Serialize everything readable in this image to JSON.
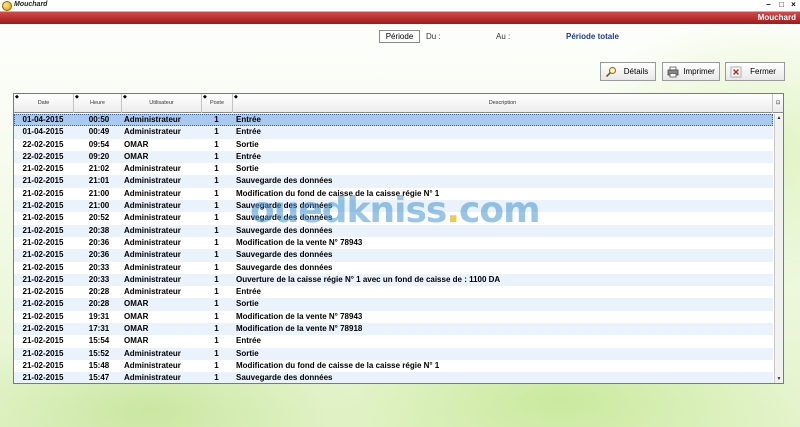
{
  "window": {
    "title": "Mouchard",
    "header_title": "Mouchard"
  },
  "period": {
    "button_label": "Période",
    "from_label": "Du :",
    "to_label": "Au :",
    "total_label": "Période totale"
  },
  "actions": {
    "details_label": "Détails",
    "print_label": "Imprimer",
    "close_label": "Fermer"
  },
  "table": {
    "columns": [
      "Date",
      "Heure",
      "Utilisateur",
      "Poste",
      "Description"
    ],
    "rows": [
      {
        "date": "01-04-2015",
        "heure": "00:50",
        "user": "Administrateur",
        "poste": "1",
        "desc": "Entrée"
      },
      {
        "date": "01-04-2015",
        "heure": "00:49",
        "user": "Administrateur",
        "poste": "1",
        "desc": "Entrée"
      },
      {
        "date": "22-02-2015",
        "heure": "09:54",
        "user": "OMAR",
        "poste": "1",
        "desc": "Sortie"
      },
      {
        "date": "22-02-2015",
        "heure": "09:20",
        "user": "OMAR",
        "poste": "1",
        "desc": "Entrée"
      },
      {
        "date": "21-02-2015",
        "heure": "21:02",
        "user": "Administrateur",
        "poste": "1",
        "desc": "Sortie"
      },
      {
        "date": "21-02-2015",
        "heure": "21:01",
        "user": "Administrateur",
        "poste": "1",
        "desc": "Sauvegarde des données"
      },
      {
        "date": "21-02-2015",
        "heure": "21:00",
        "user": "Administrateur",
        "poste": "1",
        "desc": "Modification du fond de caisse de la caisse régie N° 1"
      },
      {
        "date": "21-02-2015",
        "heure": "21:00",
        "user": "Administrateur",
        "poste": "1",
        "desc": "Sauvegarde des données"
      },
      {
        "date": "21-02-2015",
        "heure": "20:52",
        "user": "Administrateur",
        "poste": "1",
        "desc": "Sauvegarde des données"
      },
      {
        "date": "21-02-2015",
        "heure": "20:38",
        "user": "Administrateur",
        "poste": "1",
        "desc": "Sauvegarde des données"
      },
      {
        "date": "21-02-2015",
        "heure": "20:36",
        "user": "Administrateur",
        "poste": "1",
        "desc": "Modification de la vente N° 78943"
      },
      {
        "date": "21-02-2015",
        "heure": "20:36",
        "user": "Administrateur",
        "poste": "1",
        "desc": "Sauvegarde des données"
      },
      {
        "date": "21-02-2015",
        "heure": "20:33",
        "user": "Administrateur",
        "poste": "1",
        "desc": "Sauvegarde des données"
      },
      {
        "date": "21-02-2015",
        "heure": "20:33",
        "user": "Administrateur",
        "poste": "1",
        "desc": "Ouverture de la caisse régie  N° 1 avec un fond de caisse de : 1100  DA"
      },
      {
        "date": "21-02-2015",
        "heure": "20:28",
        "user": "Administrateur",
        "poste": "1",
        "desc": "Entrée"
      },
      {
        "date": "21-02-2015",
        "heure": "20:28",
        "user": "OMAR",
        "poste": "1",
        "desc": "Sortie"
      },
      {
        "date": "21-02-2015",
        "heure": "19:31",
        "user": "OMAR",
        "poste": "1",
        "desc": "Modification de la vente N° 78943"
      },
      {
        "date": "21-02-2015",
        "heure": "17:31",
        "user": "OMAR",
        "poste": "1",
        "desc": "Modification de la vente N° 78918"
      },
      {
        "date": "21-02-2015",
        "heure": "15:54",
        "user": "OMAR",
        "poste": "1",
        "desc": "Entrée"
      },
      {
        "date": "21-02-2015",
        "heure": "15:52",
        "user": "Administrateur",
        "poste": "1",
        "desc": "Sortie"
      },
      {
        "date": "21-02-2015",
        "heure": "15:48",
        "user": "Administrateur",
        "poste": "1",
        "desc": "Modification du fond de caisse de la caisse régie N° 1"
      },
      {
        "date": "21-02-2015",
        "heure": "15:47",
        "user": "Administrateur",
        "poste": "1",
        "desc": "Sauvegarde des données"
      }
    ]
  },
  "watermark": {
    "text_main": "ouedkniss",
    "text_dot": ".",
    "text_tld": "com"
  },
  "colors": {
    "header_red": "#b52a2a",
    "selected_row": "#a9c9ee",
    "period_total": "#1a3aa0"
  }
}
